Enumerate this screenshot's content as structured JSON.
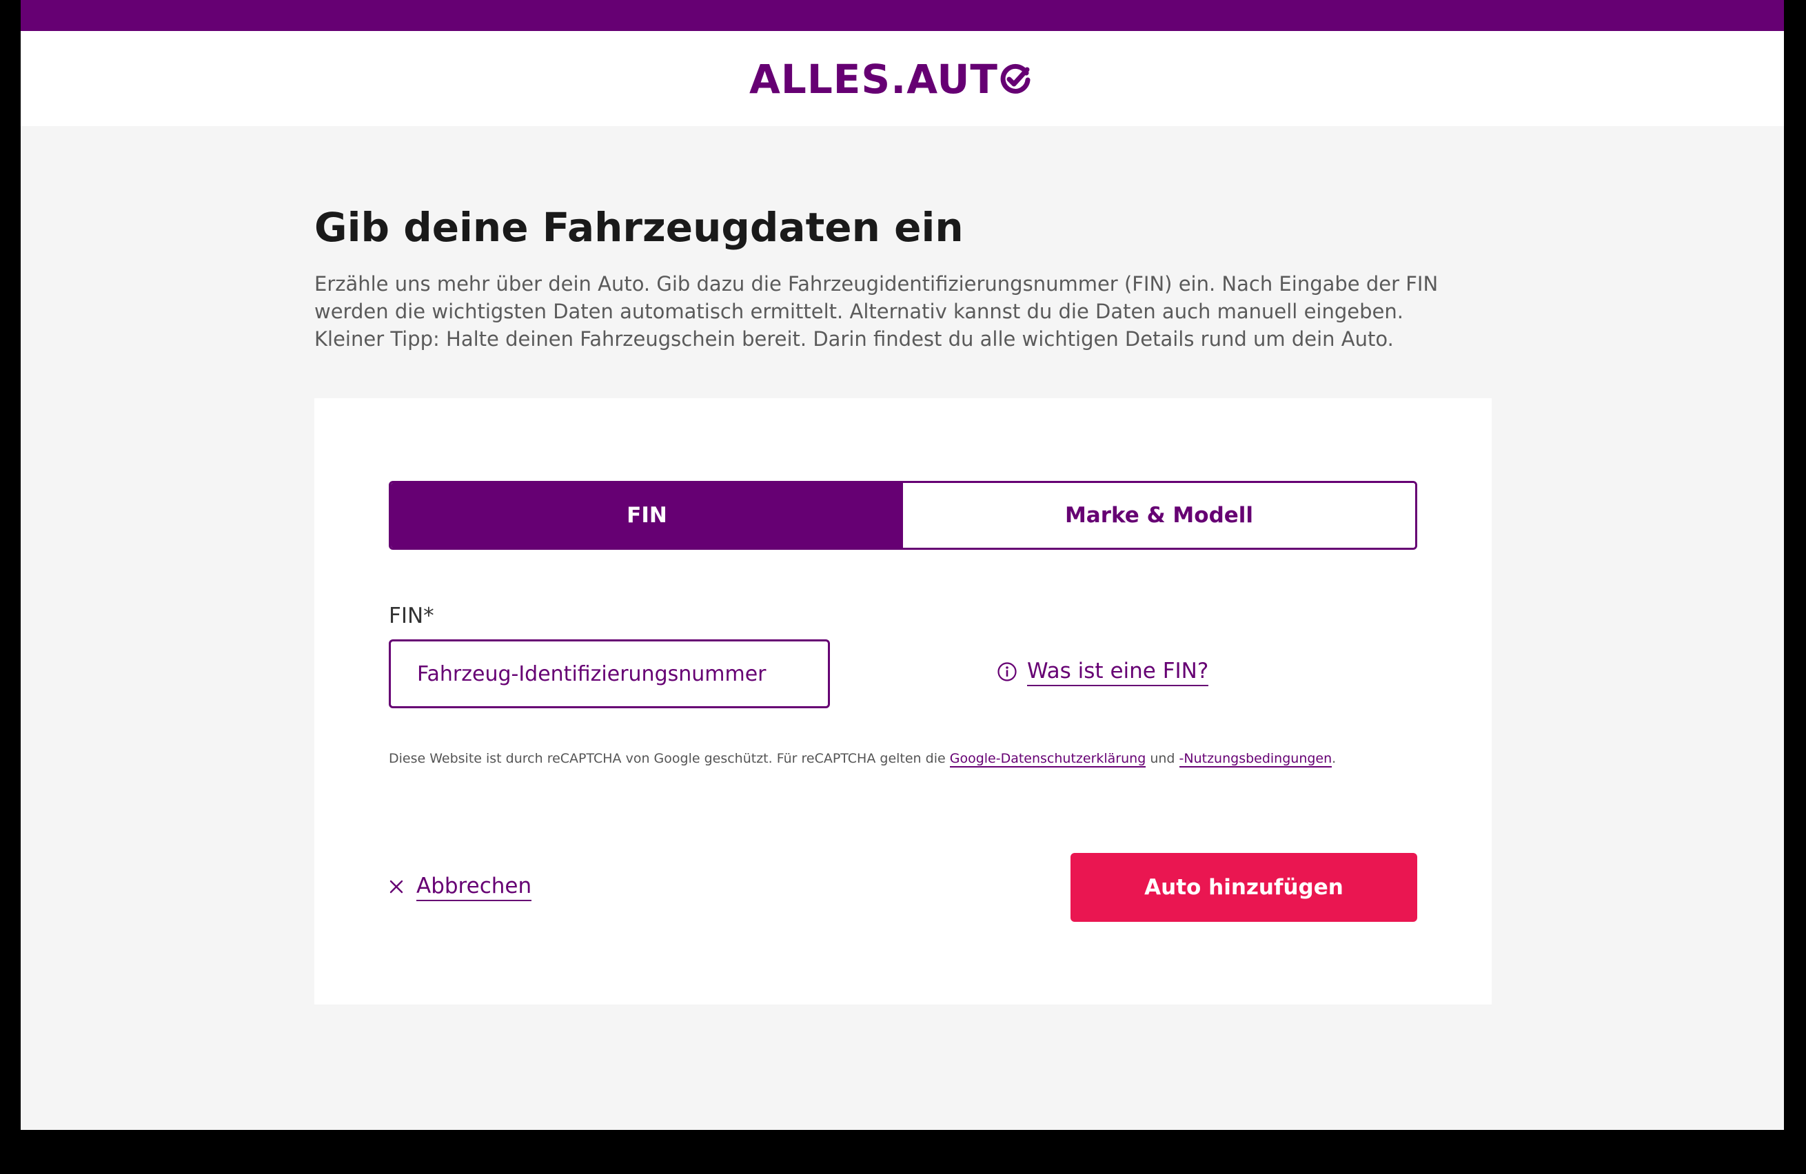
{
  "header": {
    "logo_text": "ALLES.AUT",
    "logo_check_icon": "check-circle-icon"
  },
  "main": {
    "title": "Gib deine Fahrzeugdaten ein",
    "intro_lines": [
      "Erzähle uns mehr über dein Auto. Gib dazu die Fahrzeugidentifizierungsnummer (FIN) ein. Nach Eingabe der FIN",
      "werden die wichtigsten Daten automatisch ermittelt. Alternativ kannst du die Daten auch manuell eingeben.",
      "Kleiner Tipp: Halte deinen Fahrzeugschein bereit. Darin findest du alle wichtigen Details rund um dein Auto."
    ]
  },
  "form": {
    "tabs": [
      {
        "label": "FIN",
        "active": true
      },
      {
        "label": "Marke & Modell",
        "active": false
      }
    ],
    "fin_label": "FIN*",
    "fin_placeholder": "Fahrzeug-Identifizierungsnummer",
    "fin_value": "",
    "help_link": "Was ist eine FIN?",
    "recaptcha_text": "Diese Website ist durch reCAPTCHA von Google geschützt. Für reCAPTCHA gelten die",
    "recaptcha_privacy_link": "Google-Datenschutzerklärung",
    "recaptcha_and": "und",
    "recaptcha_terms_link": "-Nutzungsbedingungen",
    "recaptcha_end": ".",
    "cancel_label": "Abbrechen",
    "submit_label": "Auto hinzufügen"
  },
  "colors": {
    "brand": "#660073",
    "accent": "#ea1651",
    "background": "#f5f5f5"
  }
}
